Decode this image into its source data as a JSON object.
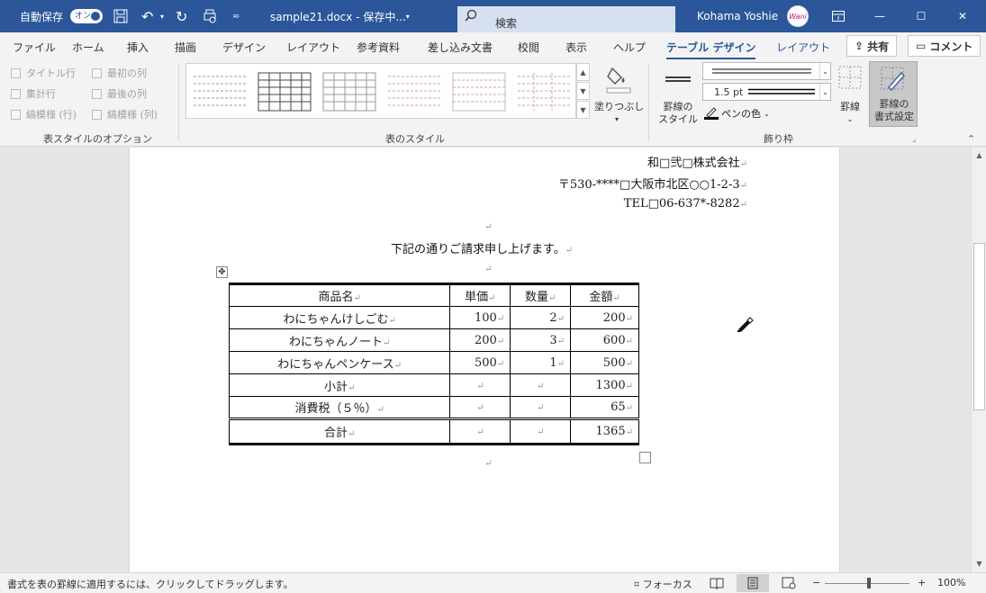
{
  "titlebar": {
    "autosave_label": "自動保存",
    "autosave_toggle": "オン",
    "filename": "sample21.docx - 保存中... ",
    "search_placeholder": "検索",
    "user_name": "Kohama Yoshie",
    "avatar_text": "Wani"
  },
  "tabs": [
    "ファイル",
    "ホーム",
    "挿入",
    "描画",
    "デザイン",
    "レイアウト",
    "参考資料",
    "差し込み文書",
    "校閲",
    "表示",
    "ヘルプ"
  ],
  "context_tabs": {
    "table_design": "テーブル デザイン",
    "layout": "レイアウト"
  },
  "share_button": "共有",
  "comment_button": "コメント",
  "ribbon": {
    "style_options": {
      "header_row": "タイトル行",
      "total_row": "集計行",
      "banded_rows": "縞模様 (行)",
      "first_column": "最初の列",
      "last_column": "最後の列",
      "banded_columns": "縞模様 (列)",
      "group_label": "表スタイルのオプション"
    },
    "table_styles": {
      "group_label": "表のスタイル",
      "shading": "塗りつぶし"
    },
    "borders": {
      "border_styles": "罫線の\nスタイル",
      "pen_weight": "1.5 pt",
      "pen_color": "ペンの色",
      "borders_button": "罫線",
      "border_painter": "罫線の\n書式設定",
      "group_label": "飾り枠"
    }
  },
  "document": {
    "company": "和□弐□株式会社",
    "address": "〒530-****□大阪市北区○○1-2-3",
    "tel": "TEL□06-637*-8282",
    "intro": "下記の通りご請求申し上げます。",
    "table": {
      "header": [
        "商品名",
        "単価",
        "数量",
        "金額"
      ],
      "rows": [
        [
          "わにちゃんけしごむ",
          "100",
          "2",
          "200"
        ],
        [
          "わにちゃんノート",
          "200",
          "3",
          "600"
        ],
        [
          "わにちゃんペンケース",
          "500",
          "1",
          "500"
        ],
        [
          "小計",
          "",
          "",
          "1300"
        ],
        [
          "消費税（５％）",
          "",
          "",
          "65"
        ]
      ],
      "total": [
        "合計",
        "",
        "",
        "1365"
      ]
    }
  },
  "statusbar": {
    "message": "書式を表の罫線に適用するには、クリックしてドラッグします。",
    "focus": "フォーカス",
    "zoom": "100%",
    "zoom_minus": "−",
    "zoom_plus": "+"
  }
}
